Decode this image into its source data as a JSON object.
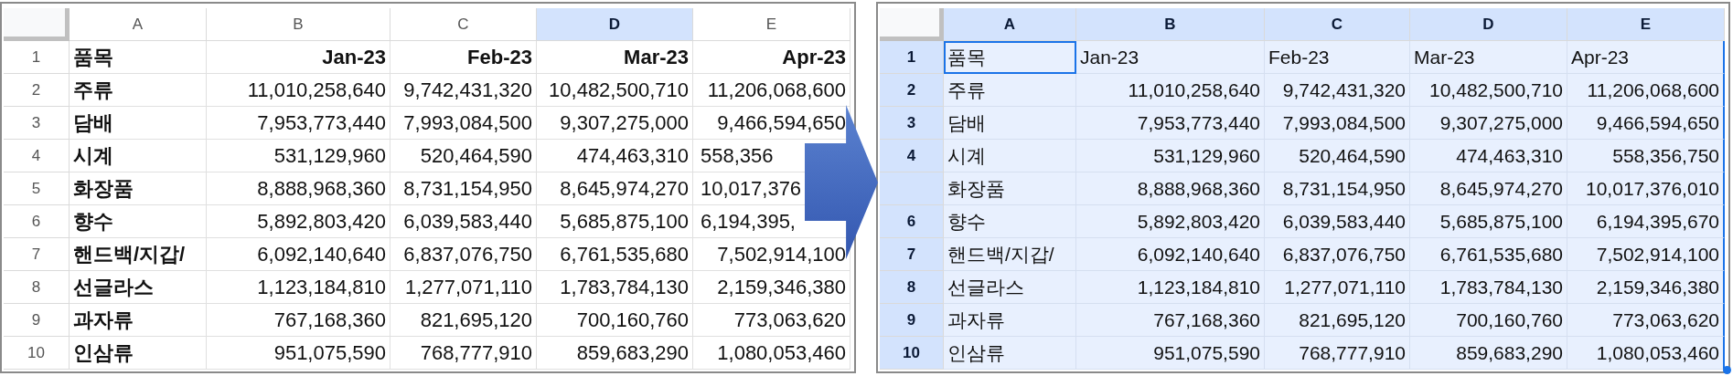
{
  "panels": [
    {
      "bold": true,
      "header_right_aligned": true,
      "range_selected": false,
      "columns": [
        {
          "label": "A",
          "selected": false
        },
        {
          "label": "B",
          "selected": false
        },
        {
          "label": "C",
          "selected": false
        },
        {
          "label": "D",
          "selected": true
        },
        {
          "label": "E",
          "selected": false
        }
      ],
      "rows": [
        {
          "number": "1",
          "selected": false,
          "kind": "header",
          "item": "품목",
          "item_active": false,
          "last_cell_covered": false,
          "values": [
            "Jan-23",
            "Feb-23",
            "Mar-23",
            "Apr-23"
          ]
        },
        {
          "number": "2",
          "selected": false,
          "kind": "data",
          "item": "주류",
          "item_active": false,
          "last_cell_covered": false,
          "values": [
            "11,010,258,640",
            "9,742,431,320",
            "10,482,500,710",
            "11,206,068,600"
          ]
        },
        {
          "number": "3",
          "selected": false,
          "kind": "data",
          "item": "담배",
          "item_active": false,
          "last_cell_covered": false,
          "values": [
            "7,953,773,440",
            "7,993,084,500",
            "9,307,275,000",
            "9,466,594,650"
          ]
        },
        {
          "number": "4",
          "selected": false,
          "kind": "data",
          "item": "시계",
          "item_active": false,
          "last_cell_covered": true,
          "values": [
            "531,129,960",
            "520,464,590",
            "474,463,310",
            "558,356"
          ]
        },
        {
          "number": "5",
          "selected": false,
          "kind": "data",
          "item": "화장품",
          "item_active": false,
          "last_cell_covered": true,
          "values": [
            "8,888,968,360",
            "8,731,154,950",
            "8,645,974,270",
            "10,017,376"
          ]
        },
        {
          "number": "6",
          "selected": false,
          "kind": "data",
          "item": "향수",
          "item_active": false,
          "last_cell_covered": true,
          "values": [
            "5,892,803,420",
            "6,039,583,440",
            "5,685,875,100",
            "6,194,395,"
          ]
        },
        {
          "number": "7",
          "selected": false,
          "kind": "data",
          "item": "핸드백/지갑/",
          "item_active": false,
          "last_cell_covered": false,
          "values": [
            "6,092,140,640",
            "6,837,076,750",
            "6,761,535,680",
            "7,502,914,100"
          ]
        },
        {
          "number": "8",
          "selected": false,
          "kind": "data",
          "item": "선글라스",
          "item_active": false,
          "last_cell_covered": false,
          "values": [
            "1,123,184,810",
            "1,277,071,110",
            "1,783,784,130",
            "2,159,346,380"
          ]
        },
        {
          "number": "9",
          "selected": false,
          "kind": "data",
          "item": "과자류",
          "item_active": false,
          "last_cell_covered": false,
          "values": [
            "767,168,360",
            "821,695,120",
            "700,160,760",
            "773,063,620"
          ]
        },
        {
          "number": "10",
          "selected": false,
          "kind": "data",
          "item": "인삼류",
          "item_active": false,
          "last_cell_covered": false,
          "values": [
            "951,075,590",
            "768,777,910",
            "859,683,290",
            "1,080,053,460"
          ]
        }
      ]
    },
    {
      "bold": false,
      "header_right_aligned": false,
      "range_selected": true,
      "columns": [
        {
          "label": "A",
          "selected": true
        },
        {
          "label": "B",
          "selected": true
        },
        {
          "label": "C",
          "selected": true
        },
        {
          "label": "D",
          "selected": true
        },
        {
          "label": "E",
          "selected": true
        }
      ],
      "rows": [
        {
          "number": "1",
          "selected": true,
          "kind": "header",
          "item": "품목",
          "item_active": true,
          "last_cell_covered": false,
          "values": [
            "Jan-23",
            "Feb-23",
            "Mar-23",
            "Apr-23"
          ]
        },
        {
          "number": "2",
          "selected": true,
          "kind": "data",
          "item": "주류",
          "item_active": false,
          "last_cell_covered": false,
          "values": [
            "11,010,258,640",
            "9,742,431,320",
            "10,482,500,710",
            "11,206,068,600"
          ]
        },
        {
          "number": "3",
          "selected": true,
          "kind": "data",
          "item": "담배",
          "item_active": false,
          "last_cell_covered": false,
          "values": [
            "7,953,773,440",
            "7,993,084,500",
            "9,307,275,000",
            "9,466,594,650"
          ]
        },
        {
          "number": "4",
          "selected": true,
          "kind": "data",
          "item": "시계",
          "item_active": false,
          "last_cell_covered": false,
          "values": [
            "531,129,960",
            "520,464,590",
            "474,463,310",
            "558,356,750"
          ]
        },
        {
          "selected": true,
          "kind": "data",
          "item": "화장품",
          "item_active": false,
          "last_cell_covered": false,
          "values": [
            "8,888,968,360",
            "8,731,154,950",
            "8,645,974,270",
            "10,017,376,010"
          ]
        },
        {
          "number": "6",
          "selected": true,
          "kind": "data",
          "item": "향수",
          "item_active": false,
          "last_cell_covered": false,
          "values": [
            "5,892,803,420",
            "6,039,583,440",
            "5,685,875,100",
            "6,194,395,670"
          ]
        },
        {
          "number": "7",
          "selected": true,
          "kind": "data",
          "item": "핸드백/지갑/",
          "item_active": false,
          "last_cell_covered": false,
          "values": [
            "6,092,140,640",
            "6,837,076,750",
            "6,761,535,680",
            "7,502,914,100"
          ]
        },
        {
          "number": "8",
          "selected": true,
          "kind": "data",
          "item": "선글라스",
          "item_active": false,
          "last_cell_covered": false,
          "values": [
            "1,123,184,810",
            "1,277,071,110",
            "1,783,784,130",
            "2,159,346,380"
          ]
        },
        {
          "number": "9",
          "selected": true,
          "kind": "data",
          "item": "과자류",
          "item_active": false,
          "last_cell_covered": false,
          "values": [
            "767,168,360",
            "821,695,120",
            "700,160,760",
            "773,063,620"
          ]
        },
        {
          "number": "10",
          "selected": true,
          "kind": "data",
          "item": "인삼류",
          "item_active": false,
          "last_cell_covered": false,
          "values": [
            "951,075,590",
            "768,777,910",
            "859,683,290",
            "1,080,053,460"
          ]
        }
      ]
    }
  ]
}
